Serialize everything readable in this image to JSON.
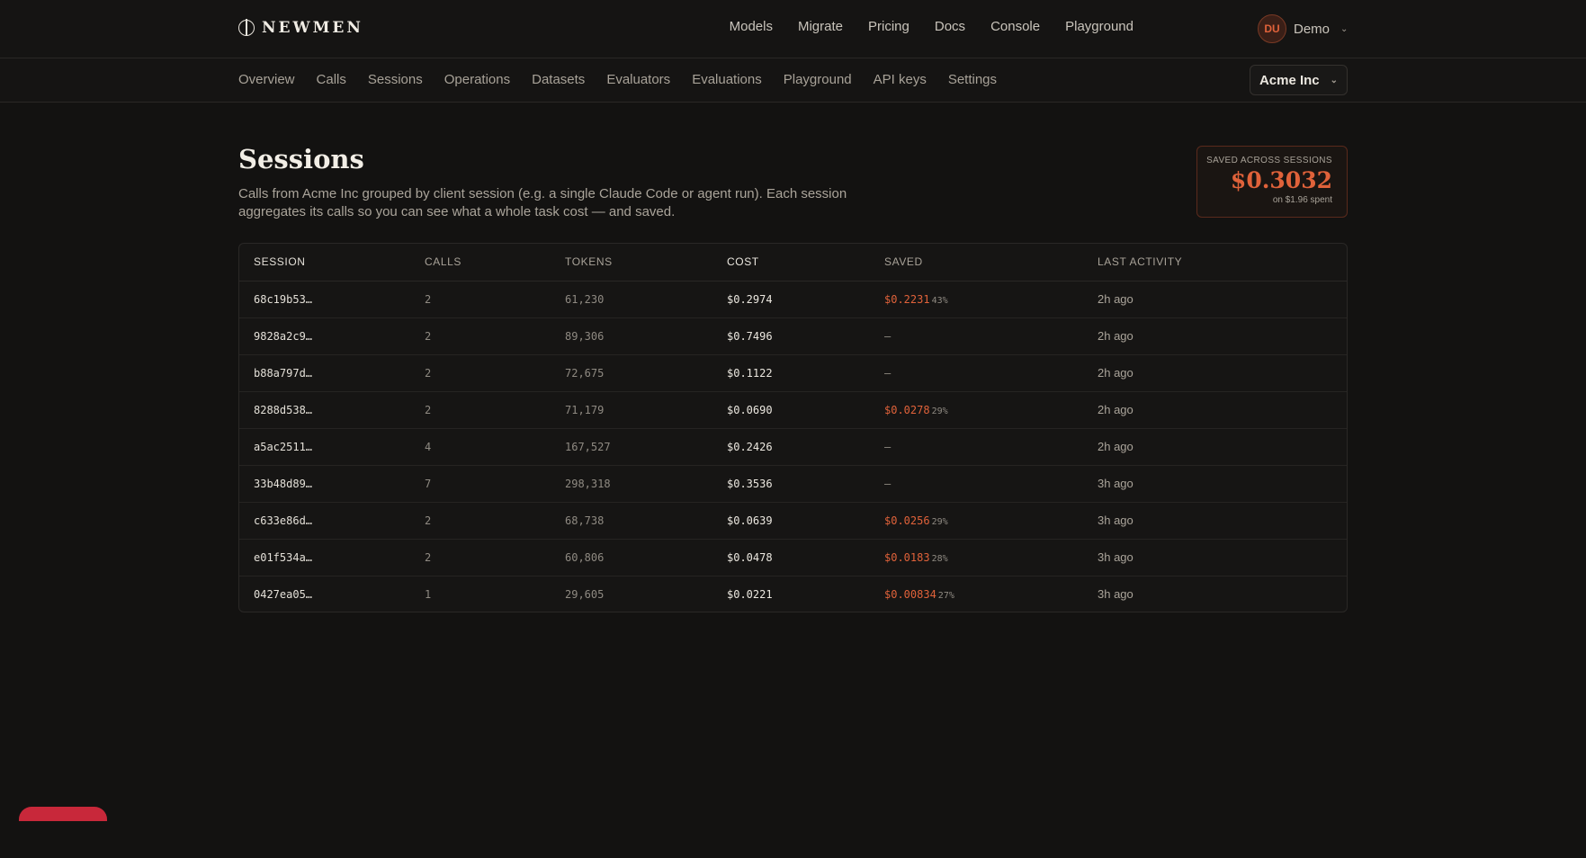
{
  "brand": {
    "name": "NEWMEN"
  },
  "topnav": [
    "Models",
    "Migrate",
    "Pricing",
    "Docs",
    "Console",
    "Playground"
  ],
  "user": {
    "initials": "DU",
    "name": "Demo"
  },
  "subnav": [
    "Overview",
    "Calls",
    "Sessions",
    "Operations",
    "Datasets",
    "Evaluators",
    "Evaluations",
    "Playground",
    "API keys",
    "Settings"
  ],
  "org": {
    "name": "Acme Inc"
  },
  "page": {
    "title": "Sessions",
    "description": "Calls from Acme Inc grouped by client session (e.g. a single Claude Code or agent run). Each session aggregates its calls so you can see what a whole task cost — and saved."
  },
  "summary": {
    "label": "SAVED ACROSS SESSIONS",
    "value": "$0.3032",
    "sub": "on $1.96 spent"
  },
  "table": {
    "headers": [
      "SESSION",
      "CALLS",
      "TOKENS",
      "COST",
      "SAVED",
      "LAST ACTIVITY"
    ],
    "rows": [
      {
        "session": "68c19b53…",
        "calls": "2",
        "tokens": "61,230",
        "cost": "$0.2974",
        "saved": "$0.2231",
        "saved_pct": "43%",
        "last": "2h ago"
      },
      {
        "session": "9828a2c9…",
        "calls": "2",
        "tokens": "89,306",
        "cost": "$0.7496",
        "saved": "—",
        "saved_pct": "",
        "last": "2h ago"
      },
      {
        "session": "b88a797d…",
        "calls": "2",
        "tokens": "72,675",
        "cost": "$0.1122",
        "saved": "—",
        "saved_pct": "",
        "last": "2h ago"
      },
      {
        "session": "8288d538…",
        "calls": "2",
        "tokens": "71,179",
        "cost": "$0.0690",
        "saved": "$0.0278",
        "saved_pct": "29%",
        "last": "2h ago"
      },
      {
        "session": "a5ac2511…",
        "calls": "4",
        "tokens": "167,527",
        "cost": "$0.2426",
        "saved": "—",
        "saved_pct": "",
        "last": "2h ago"
      },
      {
        "session": "33b48d89…",
        "calls": "7",
        "tokens": "298,318",
        "cost": "$0.3536",
        "saved": "—",
        "saved_pct": "",
        "last": "3h ago"
      },
      {
        "session": "c633e86d…",
        "calls": "2",
        "tokens": "68,738",
        "cost": "$0.0639",
        "saved": "$0.0256",
        "saved_pct": "29%",
        "last": "3h ago"
      },
      {
        "session": "e01f534a…",
        "calls": "2",
        "tokens": "60,806",
        "cost": "$0.0478",
        "saved": "$0.0183",
        "saved_pct": "28%",
        "last": "3h ago"
      },
      {
        "session": "0427ea05…",
        "calls": "1",
        "tokens": "29,605",
        "cost": "$0.0221",
        "saved": "$0.00834",
        "saved_pct": "27%",
        "last": "3h ago"
      }
    ]
  },
  "colors": {
    "accent": "#e0623a",
    "background": "#131211",
    "floating_button": "#c8283a"
  }
}
